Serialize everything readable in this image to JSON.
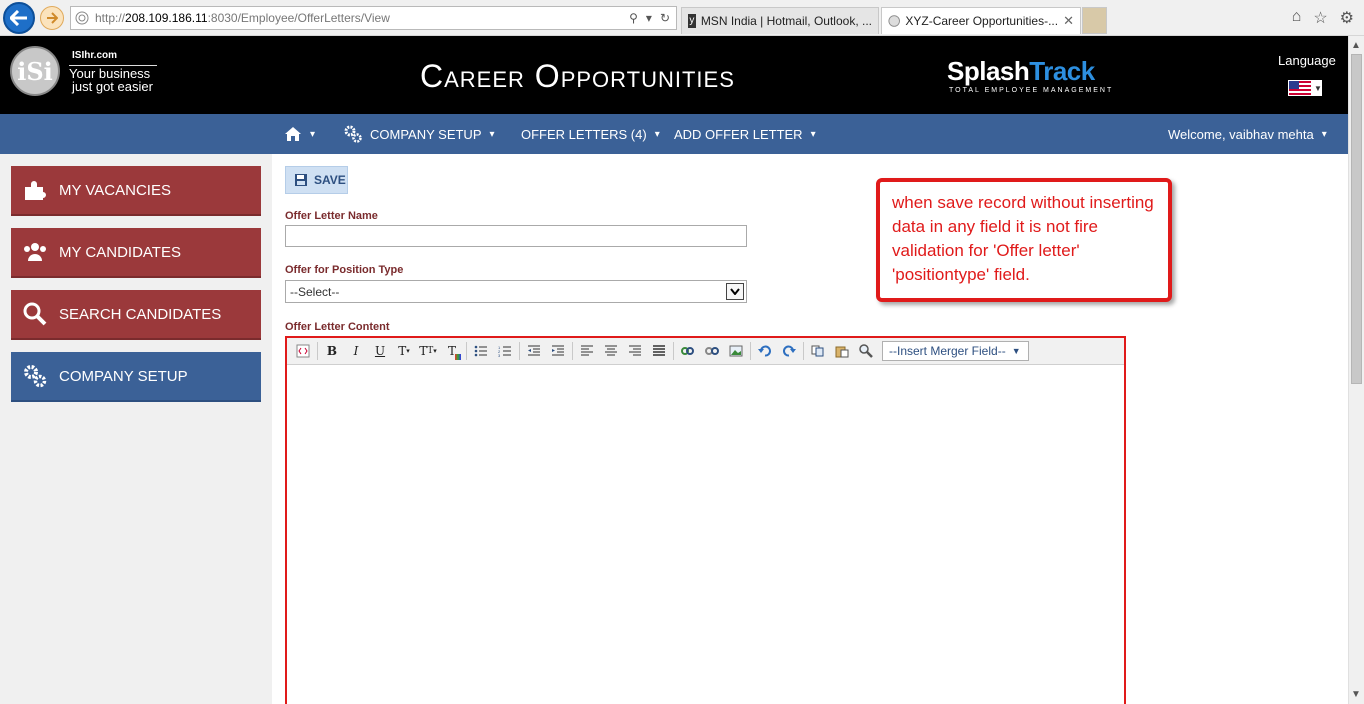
{
  "browser": {
    "url_prefix": "http://",
    "url_host": "208.109.186.11",
    "url_rest": ":8030/Employee/OfferLetters/View",
    "tabs": [
      {
        "label": "MSN India | Hotmail, Outlook, ..."
      },
      {
        "label": "XYZ-Career Opportunities-..."
      }
    ],
    "close_glyph": "✕"
  },
  "header": {
    "logo_mark": "iSi",
    "logo_domain": "ISIhr.com",
    "logo_tagline_1": "Your business",
    "logo_tagline_2": "just got easier",
    "title": "Career Opportunities",
    "brand_splash": "Splash",
    "brand_track": "Track",
    "brand_sub": "Total Employee Management",
    "language_label": "Language"
  },
  "nav": {
    "home_caret": "▾",
    "company_setup": "COMPANY SETUP",
    "offer_letters": "OFFER LETTERS (4)",
    "add_offer_letter": "ADD OFFER LETTER",
    "welcome": "Welcome, vaibhav mehta"
  },
  "sidebar": {
    "items": [
      {
        "label": "MY VACANCIES"
      },
      {
        "label": "MY CANDIDATES"
      },
      {
        "label": "SEARCH CANDIDATES"
      },
      {
        "label": "COMPANY SETUP"
      }
    ]
  },
  "form": {
    "save_label": "SAVE",
    "name_label": "Offer Letter Name",
    "name_value": "",
    "position_label": "Offer for Position Type",
    "position_value": "--Select--",
    "content_label": "Offer Letter Content",
    "merge_field": "--Insert Merger Field--"
  },
  "annotation": {
    "text": "when save record without inserting data in any field it is not fire validation for 'Offer letter' 'positiontype' field."
  },
  "colors": {
    "nav_blue": "#3b6197",
    "sidebar_red": "#9b393b",
    "annotation_red": "#e01a1a"
  }
}
